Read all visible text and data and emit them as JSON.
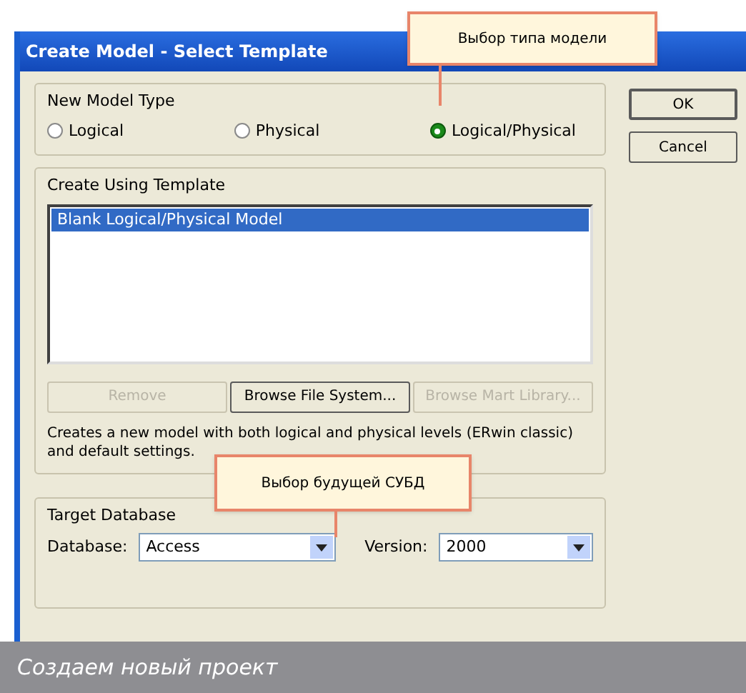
{
  "window": {
    "title": "Create Model - Select Template"
  },
  "new_model_type": {
    "label": "New Model Type",
    "options": [
      {
        "label": "Logical",
        "selected": false
      },
      {
        "label": "Physical",
        "selected": false
      },
      {
        "label": "Logical/Physical",
        "selected": true
      }
    ]
  },
  "buttons": [
    {
      "label": "OK",
      "default": true
    },
    {
      "label": "Cancel",
      "default": false
    }
  ],
  "template": {
    "label": "Create Using Template",
    "items": [
      {
        "label": "Blank Logical/Physical Model",
        "selected": true
      }
    ],
    "buttons": [
      {
        "label": "Remove",
        "disabled": true
      },
      {
        "label": "Browse File System...",
        "disabled": false
      },
      {
        "label": "Browse Mart Library...",
        "disabled": true
      }
    ],
    "description": "Creates a new model with both logical and physical levels (ERwin classic) and default settings."
  },
  "target_database": {
    "label": "Target Database",
    "database_label": "Database:",
    "database": "Access",
    "version_label": "Version:",
    "version": "2000"
  },
  "callouts": [
    {
      "text": "Выбор типа модели"
    },
    {
      "text": "Выбор будущей СУБД"
    }
  ],
  "caption": "Создаем новый проект"
}
